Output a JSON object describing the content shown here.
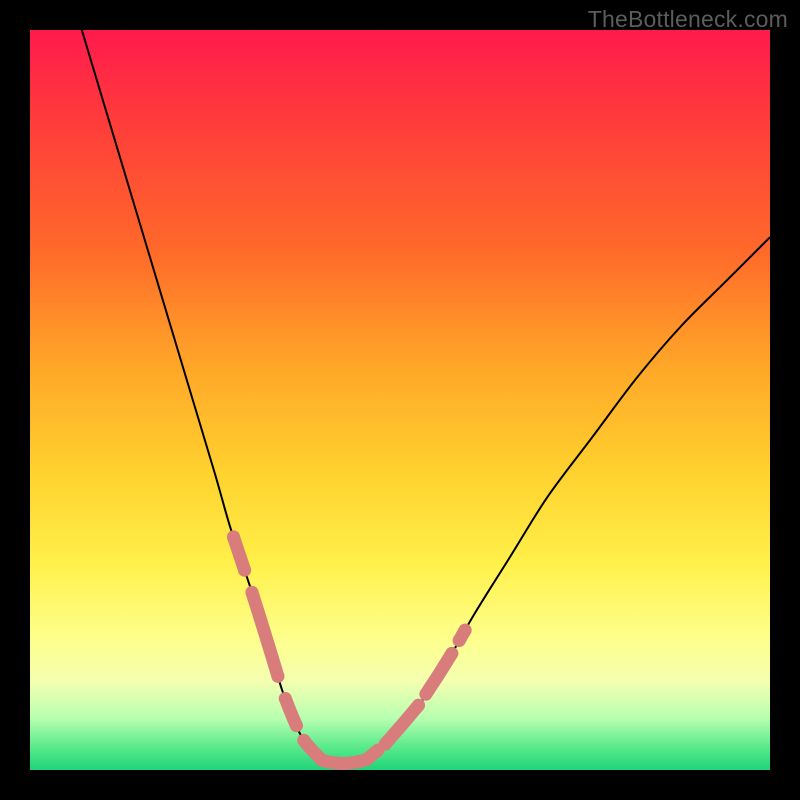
{
  "watermark": "TheBottleneck.com",
  "chart_data": {
    "type": "line",
    "title": "",
    "xlabel": "",
    "ylabel": "",
    "xlim": [
      0,
      100
    ],
    "ylim": [
      0,
      100
    ],
    "series": [
      {
        "name": "curve",
        "x": [
          7,
          10,
          13,
          16,
          19,
          22,
          25,
          27,
          29,
          31,
          32.5,
          34,
          35.5,
          37,
          39,
          42,
          45,
          48,
          52,
          56,
          60,
          65,
          70,
          76,
          82,
          88,
          94,
          100
        ],
        "values": [
          100,
          90,
          80,
          70,
          60,
          50,
          40,
          33,
          27,
          21,
          16,
          11,
          7,
          4,
          1.5,
          0.3,
          1,
          3.5,
          8,
          14,
          21,
          29,
          37,
          45,
          53,
          60,
          66,
          72
        ]
      }
    ],
    "highlight_regions": [
      {
        "branch": "left",
        "x_start": 27.5,
        "x_end": 29.0
      },
      {
        "branch": "left",
        "x_start": 30.0,
        "x_end": 33.5
      },
      {
        "branch": "left",
        "x_start": 34.5,
        "x_end": 36.0
      },
      {
        "branch": "left",
        "x_start": 37.0,
        "x_end": 39.5
      },
      {
        "branch": "valley",
        "x_start": 39.5,
        "x_end": 45.5
      },
      {
        "branch": "right",
        "x_start": 45.5,
        "x_end": 47.0
      },
      {
        "branch": "right",
        "x_start": 48.0,
        "x_end": 52.5
      },
      {
        "branch": "right",
        "x_start": 53.5,
        "x_end": 57.0
      },
      {
        "branch": "right",
        "x_start": 58.0,
        "x_end": 58.8
      }
    ],
    "highlight_dot_radius": 6.5
  },
  "gradient_colors": {
    "top": "#ff1a4d",
    "bottom": "#1fd47a"
  }
}
